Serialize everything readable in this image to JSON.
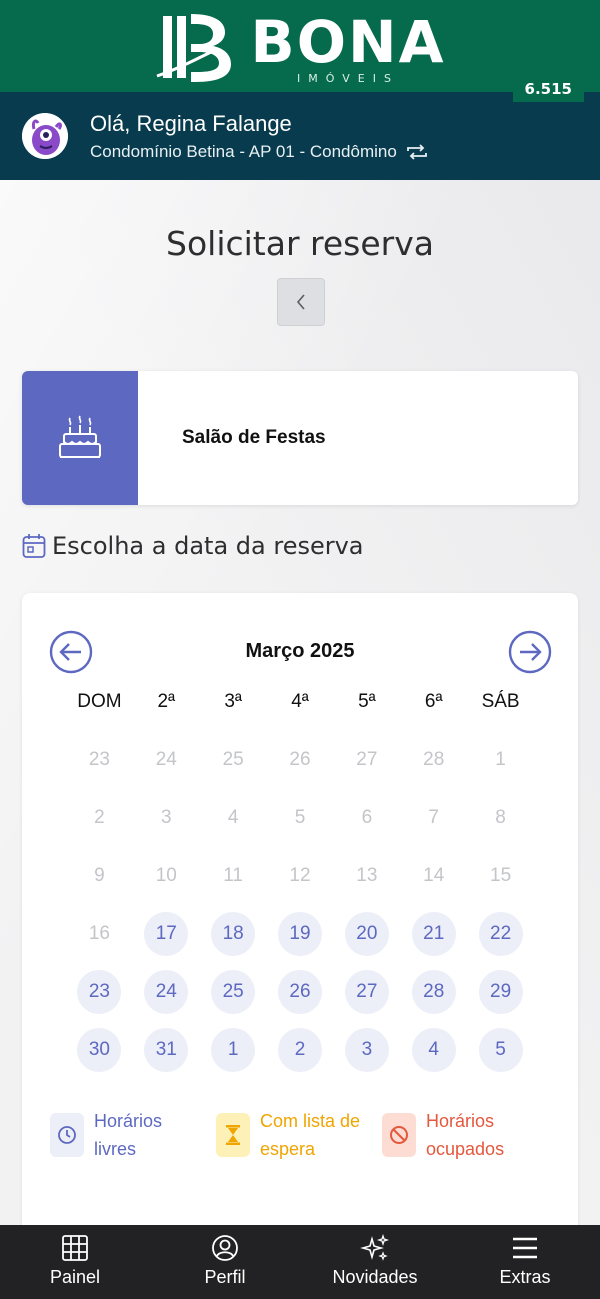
{
  "brand": {
    "name": "BONA",
    "subtitle": "IMÓVEIS",
    "points": "6.515"
  },
  "user": {
    "greeting": "Olá, Regina Falange",
    "unit": "Condomínio Betina - AP 01 - Condômino"
  },
  "page": {
    "title": "Solicitar reserva"
  },
  "space": {
    "name": "Salão de Festas",
    "accent_color": "#5d69c1"
  },
  "date_section": {
    "label": "Escolha a data da reserva"
  },
  "calendar": {
    "month": "Março 2025",
    "weekdays": [
      "DOM",
      "2ª",
      "3ª",
      "4ª",
      "5ª",
      "6ª",
      "SÁB"
    ],
    "days": [
      {
        "n": "23",
        "state": "disabled"
      },
      {
        "n": "24",
        "state": "disabled"
      },
      {
        "n": "25",
        "state": "disabled"
      },
      {
        "n": "26",
        "state": "disabled"
      },
      {
        "n": "27",
        "state": "disabled"
      },
      {
        "n": "28",
        "state": "disabled"
      },
      {
        "n": "1",
        "state": "disabled"
      },
      {
        "n": "2",
        "state": "disabled"
      },
      {
        "n": "3",
        "state": "disabled"
      },
      {
        "n": "4",
        "state": "disabled"
      },
      {
        "n": "5",
        "state": "disabled"
      },
      {
        "n": "6",
        "state": "disabled"
      },
      {
        "n": "7",
        "state": "disabled"
      },
      {
        "n": "8",
        "state": "disabled"
      },
      {
        "n": "9",
        "state": "disabled"
      },
      {
        "n": "10",
        "state": "disabled"
      },
      {
        "n": "11",
        "state": "disabled"
      },
      {
        "n": "12",
        "state": "disabled"
      },
      {
        "n": "13",
        "state": "disabled"
      },
      {
        "n": "14",
        "state": "disabled"
      },
      {
        "n": "15",
        "state": "disabled"
      },
      {
        "n": "16",
        "state": "disabled"
      },
      {
        "n": "17",
        "state": "available"
      },
      {
        "n": "18",
        "state": "available"
      },
      {
        "n": "19",
        "state": "available"
      },
      {
        "n": "20",
        "state": "available"
      },
      {
        "n": "21",
        "state": "available"
      },
      {
        "n": "22",
        "state": "available"
      },
      {
        "n": "23",
        "state": "available"
      },
      {
        "n": "24",
        "state": "available"
      },
      {
        "n": "25",
        "state": "available"
      },
      {
        "n": "26",
        "state": "available"
      },
      {
        "n": "27",
        "state": "available"
      },
      {
        "n": "28",
        "state": "available"
      },
      {
        "n": "29",
        "state": "available"
      },
      {
        "n": "30",
        "state": "available"
      },
      {
        "n": "31",
        "state": "available"
      },
      {
        "n": "1",
        "state": "available"
      },
      {
        "n": "2",
        "state": "available"
      },
      {
        "n": "3",
        "state": "available"
      },
      {
        "n": "4",
        "state": "available"
      },
      {
        "n": "5",
        "state": "available"
      }
    ]
  },
  "legend": [
    {
      "label_line1": "Horários",
      "label_line2": "livres",
      "color": "#5d69c1",
      "bg": "#eceef8",
      "icon": "clock-icon"
    },
    {
      "label_line1": "Com lista de",
      "label_line2": "espera",
      "color": "#f0a500",
      "bg": "#fdf1b8",
      "icon": "hourglass-icon"
    },
    {
      "label_line1": "Horários",
      "label_line2": "ocupados",
      "color": "#e4583e",
      "bg": "#fcdcd3",
      "icon": "block-icon"
    }
  ],
  "nav": [
    {
      "label": "Painel",
      "icon": "grid-icon"
    },
    {
      "label": "Perfil",
      "icon": "user-circle-icon"
    },
    {
      "label": "Novidades",
      "icon": "sparkles-icon"
    },
    {
      "label": "Extras",
      "icon": "menu-icon"
    }
  ]
}
